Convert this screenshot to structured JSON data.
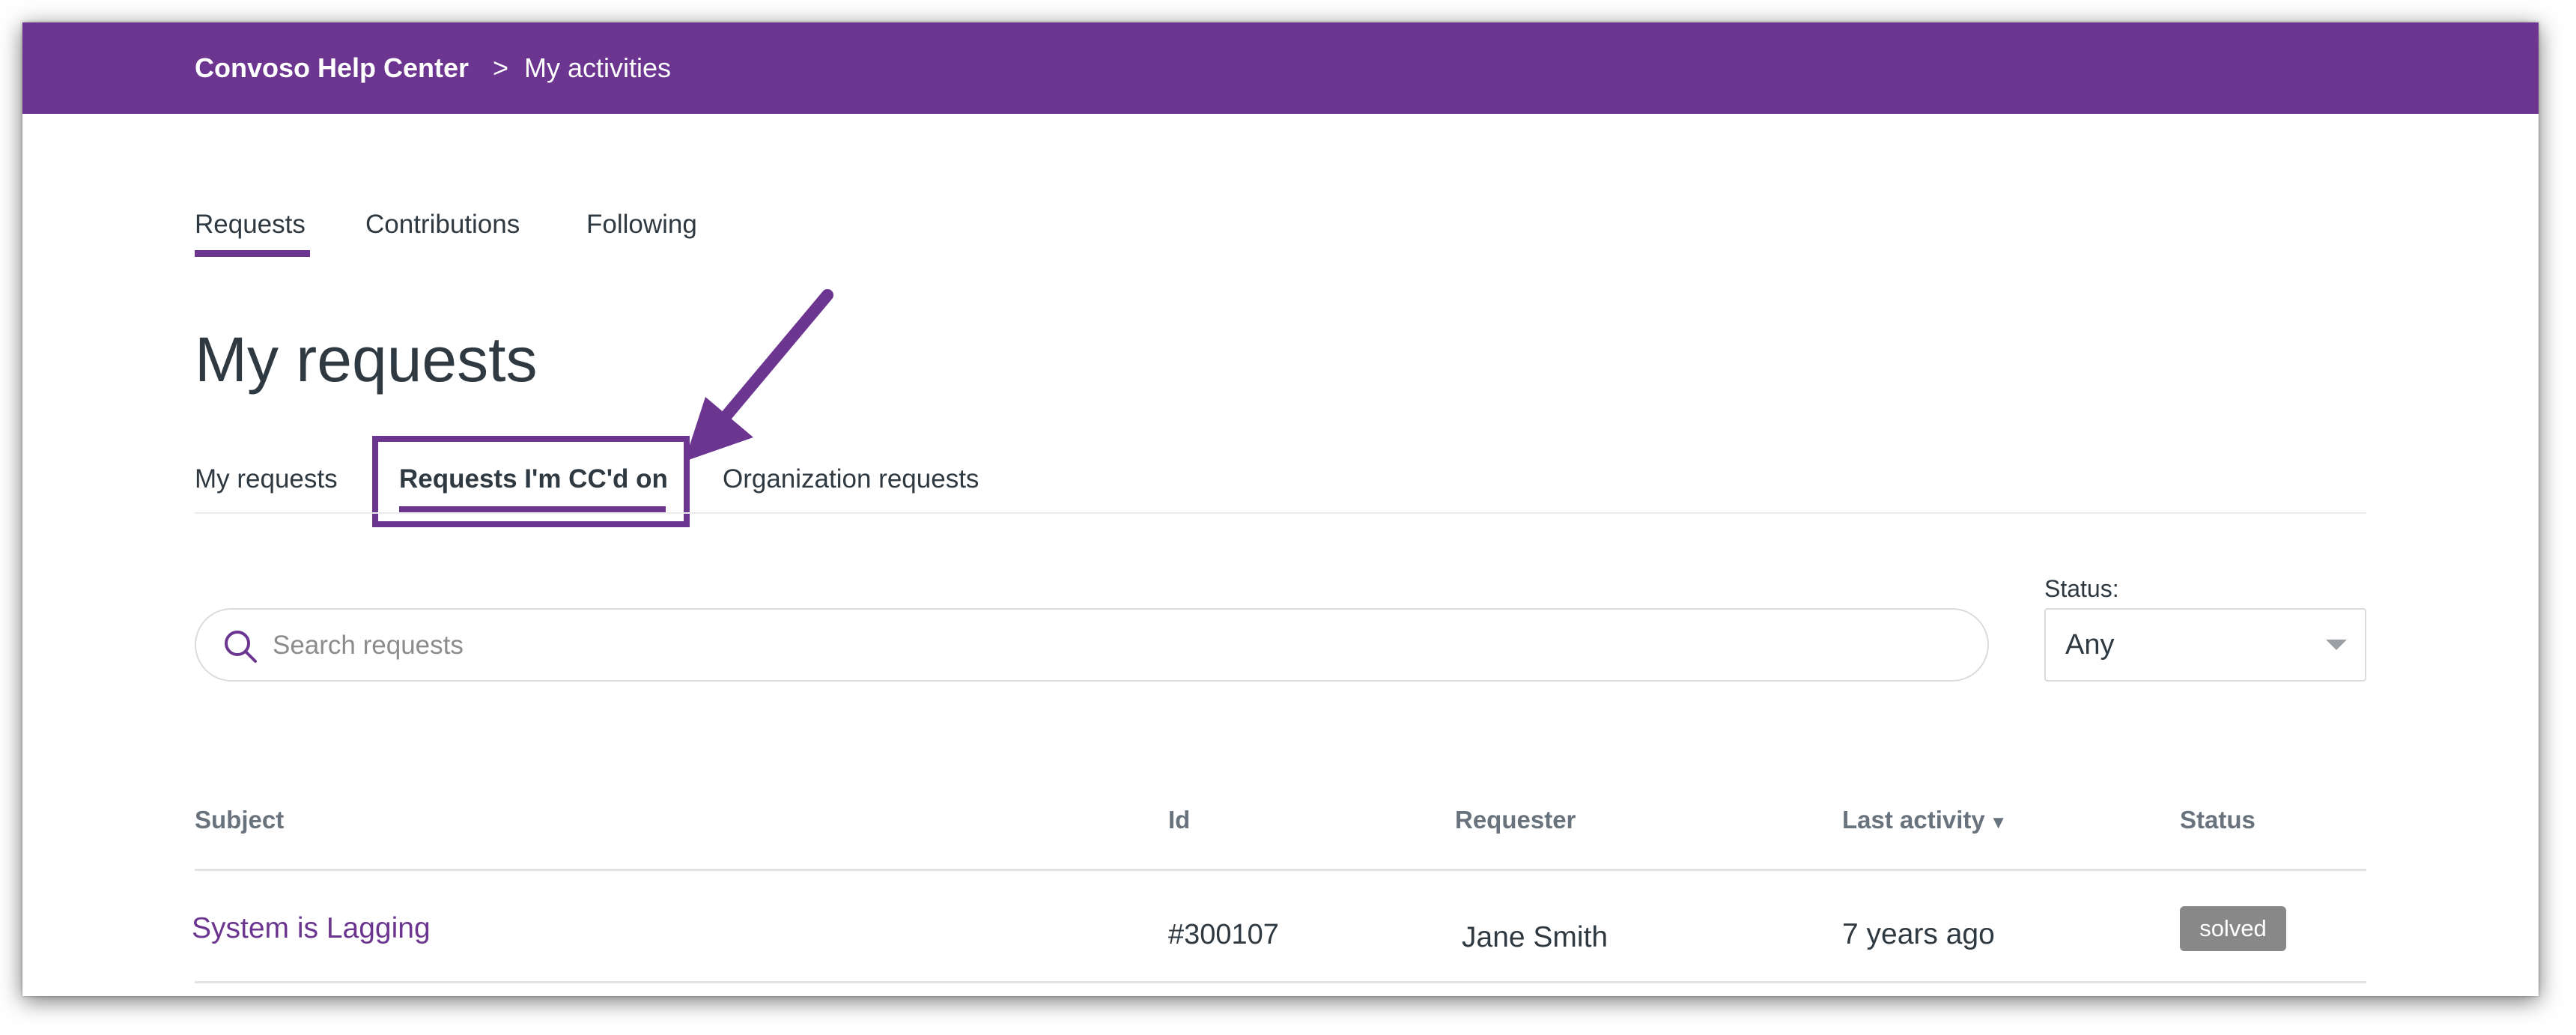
{
  "colors": {
    "brand": "#6b3590",
    "badge_solved": "#888888"
  },
  "breadcrumb": {
    "home": "Convoso Help Center",
    "separator": ">",
    "current": "My activities"
  },
  "nav_tabs": [
    {
      "label": "Requests",
      "active": true
    },
    {
      "label": "Contributions",
      "active": false
    },
    {
      "label": "Following",
      "active": false
    }
  ],
  "page_title": "My requests",
  "sub_tabs": [
    {
      "label": "My requests",
      "active": false
    },
    {
      "label": "Requests I'm CC'd on",
      "active": true
    },
    {
      "label": "Organization requests",
      "active": false
    }
  ],
  "search": {
    "placeholder": "Search requests",
    "value": "",
    "icon": "search-icon"
  },
  "status_filter": {
    "label": "Status:",
    "selected": "Any"
  },
  "table": {
    "columns": [
      "Subject",
      "Id",
      "Requester",
      "Last activity",
      "Status"
    ],
    "sort_column": "Last activity",
    "sort_indicator": "▼",
    "rows": [
      {
        "subject": "System is Lagging",
        "id": "#300107",
        "requester": "Jane Smith",
        "last_activity": "7 years ago",
        "status": "solved"
      }
    ]
  }
}
